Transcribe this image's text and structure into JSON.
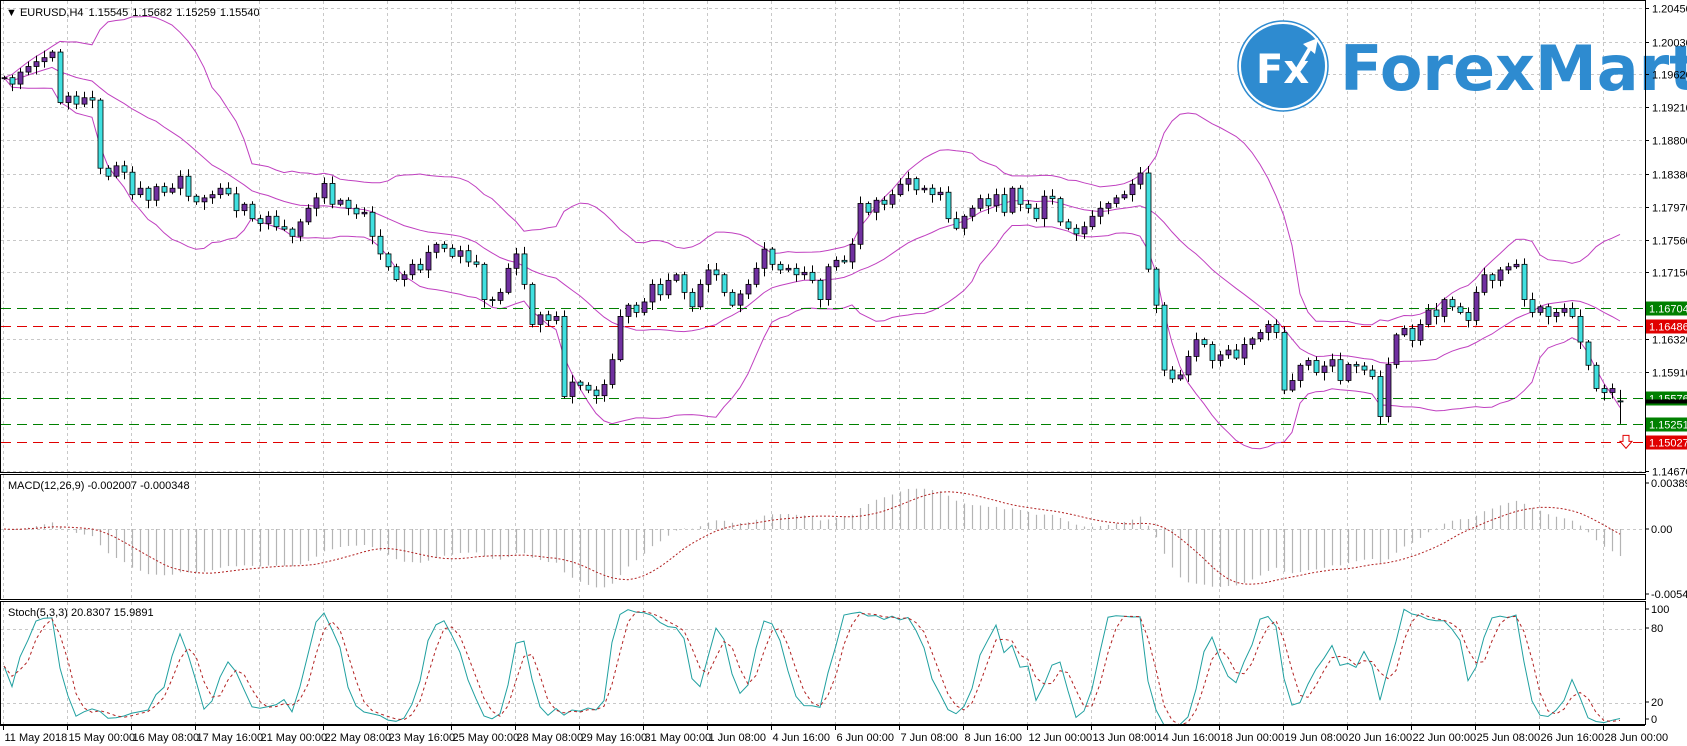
{
  "header": {
    "symbol": "EURUSD,H4",
    "open": "1.15545",
    "high": "1.15682",
    "low": "1.15259",
    "close": "1.15540"
  },
  "logo": {
    "mark": "Fx",
    "text": "ForexMart",
    "color": "#2e8bd0"
  },
  "colors": {
    "bull_candle": "#7030a0",
    "bear_candle": "#40e0e0",
    "bands": "#c040c0",
    "macd_hist": "#b4b4b4",
    "macd_signal": "#b22222",
    "stoch_main": "#20a0a0",
    "stoch_signal": "#b22222",
    "level_green": "#008000",
    "level_red": "#e00000"
  },
  "chart_data": {
    "type": "candlestick",
    "symbol": "EURUSD",
    "timeframe": "H4",
    "ylim": [
      1.1467,
      1.2045
    ],
    "y_ticks": [
      "1.20450",
      "1.20030",
      "1.19620",
      "1.19210",
      "1.18800",
      "1.18380",
      "1.17970",
      "1.17560",
      "1.17150",
      "1.16320",
      "1.15910",
      "1.14670"
    ],
    "x_labels": [
      "11 May 2018",
      "15 May 00:00",
      "16 May 08:00",
      "17 May 16:00",
      "21 May 00:00",
      "22 May 08:00",
      "23 May 16:00",
      "25 May 00:00",
      "28 May 08:00",
      "29 May 16:00",
      "31 May 00:00",
      "1 Jun 08:00",
      "4 Jun 16:00",
      "6 Jun 00:00",
      "7 Jun 08:00",
      "8 Jun 16:00",
      "12 Jun 00:00",
      "13 Jun 08:00",
      "14 Jun 16:00",
      "18 Jun 00:00",
      "19 Jun 08:00",
      "20 Jun 16:00",
      "22 Jun 00:00",
      "25 Jun 08:00",
      "26 Jun 16:00",
      "28 Jun 00:00"
    ],
    "grid": true,
    "close": [
      1.1958,
      1.195,
      1.1965,
      1.1972,
      1.1978,
      1.1983,
      1.199,
      1.1927,
      1.1935,
      1.1925,
      1.1933,
      1.193,
      1.1845,
      1.1835,
      1.1848,
      1.184,
      1.1812,
      1.182,
      1.1805,
      1.1822,
      1.1815,
      1.182,
      1.1835,
      1.181,
      1.1803,
      1.1808,
      1.1812,
      1.182,
      1.1813,
      1.1792,
      1.18,
      1.1782,
      1.1776,
      1.1785,
      1.1772,
      1.1769,
      1.176,
      1.1778,
      1.1795,
      1.1808,
      1.1826,
      1.18,
      1.1805,
      1.1795,
      1.1788,
      1.179,
      1.176,
      1.1738,
      1.1722,
      1.1706,
      1.1712,
      1.1725,
      1.1718,
      1.174,
      1.175,
      1.1745,
      1.1735,
      1.1742,
      1.1728,
      1.1725,
      1.1681,
      1.168,
      1.169,
      1.172,
      1.1738,
      1.17,
      1.165,
      1.1662,
      1.1655,
      1.166,
      1.156,
      1.1578,
      1.1574,
      1.1568,
      1.1561,
      1.1575,
      1.1606,
      1.166,
      1.1674,
      1.1665,
      1.1678,
      1.17,
      1.1687,
      1.1705,
      1.1712,
      1.169,
      1.1672,
      1.17,
      1.1718,
      1.1712,
      1.169,
      1.1674,
      1.1688,
      1.17,
      1.172,
      1.1744,
      1.1725,
      1.1718,
      1.172,
      1.1712,
      1.1715,
      1.1705,
      1.1681,
      1.1722,
      1.173,
      1.1728,
      1.175,
      1.1801,
      1.179,
      1.1805,
      1.18,
      1.1812,
      1.1825,
      1.1832,
      1.1818,
      1.182,
      1.1812,
      1.1815,
      1.1782,
      1.177,
      1.1785,
      1.1795,
      1.1807,
      1.1798,
      1.1812,
      1.179,
      1.182,
      1.18,
      1.1795,
      1.1782,
      1.181,
      1.1807,
      1.1778,
      1.177,
      1.1763,
      1.1772,
      1.1785,
      1.1795,
      1.1801,
      1.1808,
      1.1812,
      1.1825,
      1.1839,
      1.1719,
      1.1674,
      1.1593,
      1.1582,
      1.1587,
      1.161,
      1.1631,
      1.1625,
      1.1605,
      1.1612,
      1.1618,
      1.1608,
      1.1625,
      1.1632,
      1.164,
      1.165,
      1.164,
      1.1568,
      1.158,
      1.1599,
      1.1605,
      1.159,
      1.1598,
      1.1606,
      1.158,
      1.16,
      1.1598,
      1.1593,
      1.1585,
      1.1535,
      1.16,
      1.1637,
      1.1645,
      1.163,
      1.165,
      1.1668,
      1.166,
      1.1681,
      1.1672,
      1.1665,
      1.1655,
      1.169,
      1.1712,
      1.1705,
      1.1718,
      1.1722,
      1.1725,
      1.1681,
      1.1665,
      1.1672,
      1.166,
      1.1665,
      1.167,
      1.166,
      1.1628,
      1.1599,
      1.157,
      1.1565,
      1.157,
      1.1554
    ],
    "last_bar": {
      "open": 1.15545,
      "high": 1.15682,
      "low": 1.15259,
      "close": 1.1554
    },
    "levels": [
      {
        "price": "1.16704",
        "color": "green"
      },
      {
        "price": "1.16486",
        "color": "red"
      },
      {
        "price": "1.15576",
        "color": "green"
      },
      {
        "price": "1.15251",
        "color": "green"
      },
      {
        "price": "1.15027",
        "color": "red"
      }
    ],
    "bollinger": {
      "period": 20,
      "deviation": 2
    },
    "macd": {
      "label": "MACD(12,26,9) -0.002007 -0.000348",
      "ylim": [
        -0.005404,
        0.003893
      ],
      "y_ticks": [
        "0.003893",
        "0.00",
        "-0.005404"
      ]
    },
    "stoch": {
      "label": "Stoch(5,3,3) 20.8307 15.9891",
      "ylim": [
        0,
        100
      ],
      "y_ticks": [
        "100",
        "80",
        "20",
        "0"
      ]
    },
    "sell_arrow_icon": "down-arrow"
  }
}
